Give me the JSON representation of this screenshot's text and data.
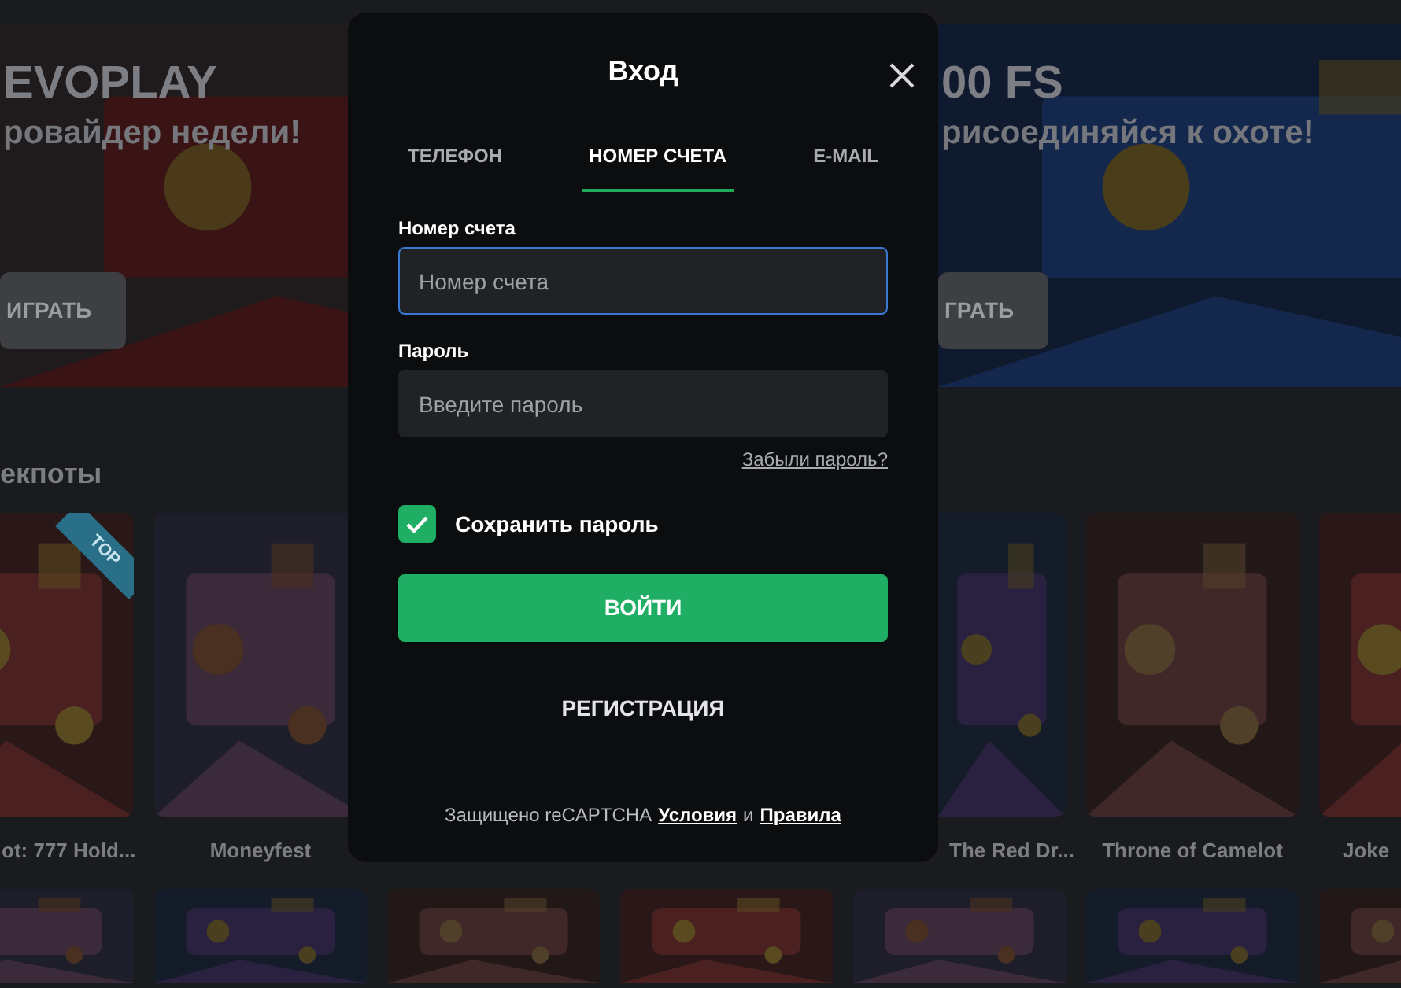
{
  "background": {
    "banners": [
      {
        "title": "EVOPLAY",
        "subtitle": "ровайдер недели!",
        "button": "ИГРАТЬ"
      },
      {
        "title": "00 FS",
        "subtitle": "рисоединяйся к охоте!",
        "button": "ГРАТЬ"
      }
    ],
    "section_title": "екпоты",
    "games_left": [
      {
        "title": "ot: 777 Hold...",
        "badge": "TOP"
      },
      {
        "title": "Moneyfest"
      }
    ],
    "games_right": [
      {
        "title": "The Red Dr...",
        "cut": true
      },
      {
        "title": "Throne of Camelot"
      },
      {
        "title": "Joke"
      }
    ]
  },
  "dialog": {
    "title": "Вход",
    "tabs": [
      {
        "label": "ТЕЛЕФОН",
        "selected": false
      },
      {
        "label": "НОМЕР СЧЕТА",
        "selected": true
      },
      {
        "label": "E-MAIL",
        "selected": false
      }
    ],
    "fields": [
      {
        "label": "Номер счета",
        "placeholder": "Номер счета",
        "focused": true
      },
      {
        "label": "Пароль",
        "placeholder": "Введите пароль",
        "focused": false
      }
    ],
    "forgot_link": "Забыли пароль?",
    "remember": {
      "label": "Сохранить пароль",
      "checked": true
    },
    "login_button": "ВОЙТИ",
    "register_button": "РЕГИСТРАЦИЯ",
    "footer": {
      "text": "Защищено reCAPTCHA",
      "links": [
        "Условия",
        "Правила"
      ],
      "joiner": "и"
    }
  }
}
